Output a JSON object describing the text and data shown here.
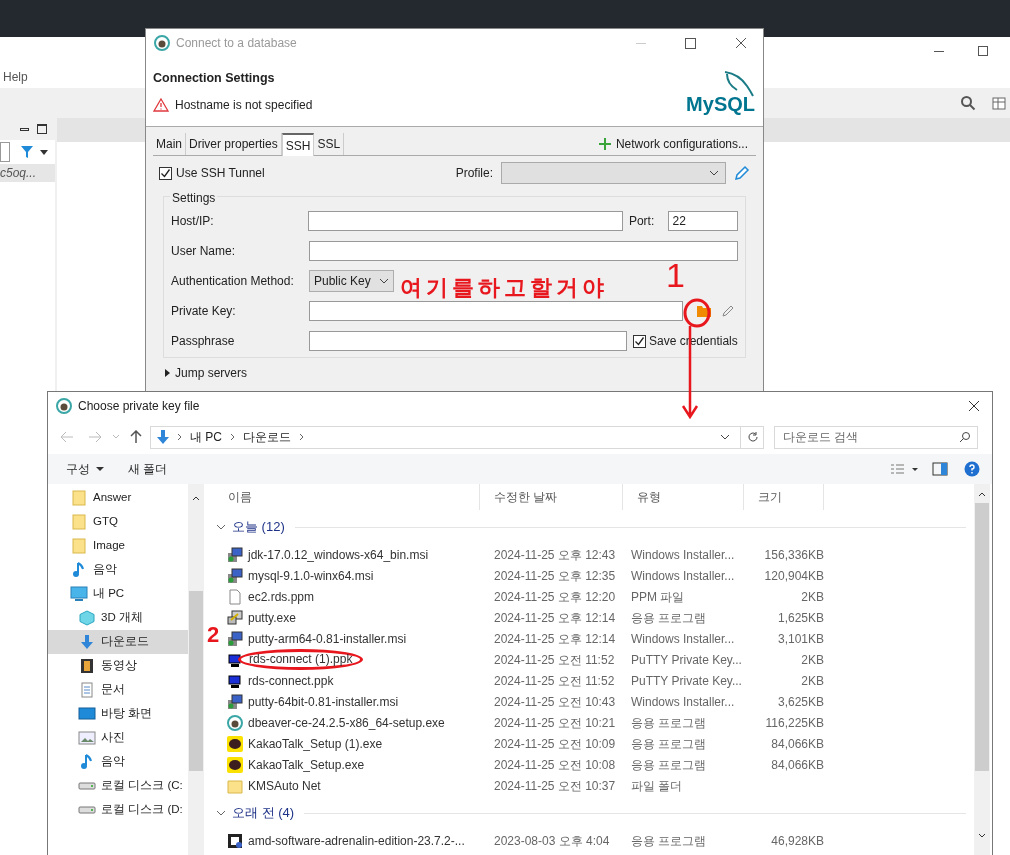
{
  "background_app": {
    "menu": [
      "Help"
    ],
    "panel_item": "c5oq..."
  },
  "connection_dialog": {
    "title": "Connect to a database",
    "heading": "Connection Settings",
    "warning": "Hostname is not specified",
    "logo": "MySQL",
    "tabs": [
      {
        "label": "Main",
        "selected": false
      },
      {
        "label": "Driver properties",
        "selected": false
      },
      {
        "label": "SSH",
        "selected": true
      },
      {
        "label": "SSL",
        "selected": false
      }
    ],
    "network_button": "Network configurations...",
    "use_ssh_tunnel": {
      "label": "Use SSH Tunnel",
      "checked": true
    },
    "profile_label": "Profile:",
    "settings": {
      "title": "Settings",
      "host_label": "Host/IP:",
      "port_label": "Port:",
      "port_value": "22",
      "user_label": "User Name:",
      "auth_label": "Authentication Method:",
      "auth_value": "Public Key",
      "private_key_label": "Private Key:",
      "passphrase_label": "Passphrase",
      "save_credentials": {
        "label": "Save credentials",
        "checked": true
      }
    },
    "sections": [
      {
        "label": "Jump servers",
        "expanded": false
      }
    ]
  },
  "file_dialog": {
    "title": "Choose private key file",
    "breadcrumb": [
      "내 PC",
      "다운로드"
    ],
    "search_placeholder": "다운로드 검색",
    "toolbar": [
      "구성",
      "새 폴더"
    ],
    "nav": [
      {
        "label": "Answer",
        "kind": "folder",
        "selected": false
      },
      {
        "label": "GTQ",
        "kind": "folder",
        "selected": false
      },
      {
        "label": "Image",
        "kind": "folder",
        "selected": false
      },
      {
        "label": "음악",
        "kind": "music",
        "selected": false
      },
      {
        "label": "내 PC",
        "kind": "pc",
        "selected": false,
        "children": [
          {
            "label": "3D 개체",
            "kind": "cube",
            "selected": false
          },
          {
            "label": "다운로드",
            "kind": "download",
            "selected": true
          },
          {
            "label": "동영상",
            "kind": "film",
            "selected": false
          },
          {
            "label": "문서",
            "kind": "doc",
            "selected": false
          },
          {
            "label": "바탕 화면",
            "kind": "desktop",
            "selected": false
          },
          {
            "label": "사진",
            "kind": "photo",
            "selected": false
          },
          {
            "label": "음악",
            "kind": "music",
            "selected": false
          },
          {
            "label": "로컬 디스크 (C:",
            "kind": "disk",
            "selected": false
          },
          {
            "label": "로컬 디스크 (D:",
            "kind": "disk",
            "selected": false
          }
        ]
      }
    ],
    "columns": [
      "이름",
      "수정한 날짜",
      "유형",
      "크기"
    ],
    "groups": [
      {
        "label": "오늘 (12)",
        "expanded": true,
        "files": [
          {
            "name": "jdk-17.0.12_windows-x64_bin.msi",
            "date": "2024-11-25 오후 12:43",
            "type": "Windows Installer...",
            "size": "156,336KB",
            "kind": "installer"
          },
          {
            "name": "mysql-9.1.0-winx64.msi",
            "date": "2024-11-25 오후 12:35",
            "type": "Windows Installer...",
            "size": "120,904KB",
            "kind": "installer"
          },
          {
            "name": "ec2.rds.ppm",
            "date": "2024-11-25 오후 12:20",
            "type": "PPM 파일",
            "size": "2KB",
            "kind": "document"
          },
          {
            "name": "putty.exe",
            "date": "2024-11-25 오후 12:14",
            "type": "응용 프로그램",
            "size": "1,625KB",
            "kind": "putty"
          },
          {
            "name": "putty-arm64-0.81-installer.msi",
            "date": "2024-11-25 오후 12:14",
            "type": "Windows Installer...",
            "size": "3,101KB",
            "kind": "installer"
          },
          {
            "name": "rds-connect (1).ppk",
            "date": "2024-11-25 오전 11:52",
            "type": "PuTTY Private Key...",
            "size": "2KB",
            "kind": "key",
            "circled": true
          },
          {
            "name": "rds-connect.ppk",
            "date": "2024-11-25 오전 11:52",
            "type": "PuTTY Private Key...",
            "size": "2KB",
            "kind": "key"
          },
          {
            "name": "putty-64bit-0.81-installer.msi",
            "date": "2024-11-25 오전 10:43",
            "type": "Windows Installer...",
            "size": "3,625KB",
            "kind": "installer"
          },
          {
            "name": "dbeaver-ce-24.2.5-x86_64-setup.exe",
            "date": "2024-11-25 오전 10:21",
            "type": "응용 프로그램",
            "size": "116,225KB",
            "kind": "beaver"
          },
          {
            "name": "KakaoTalk_Setup (1).exe",
            "date": "2024-11-25 오전 10:09",
            "type": "응용 프로그램",
            "size": "84,066KB",
            "kind": "chat"
          },
          {
            "name": "KakaoTalk_Setup.exe",
            "date": "2024-11-25 오전 10:08",
            "type": "응용 프로그램",
            "size": "84,066KB",
            "kind": "chat"
          },
          {
            "name": "KMSAuto Net",
            "date": "2024-11-25 오전 10:37",
            "type": "파일 폴더",
            "kind": "folder"
          }
        ]
      },
      {
        "label": "오래 전 (4)",
        "expanded": true,
        "files": [
          {
            "name": "amd-software-adrenalin-edition-23.7.2-...",
            "date": "2023-08-03 오후 4:04",
            "type": "응용 프로그램",
            "size": "46,928KB",
            "kind": "amd"
          }
        ]
      }
    ]
  },
  "annotations": {
    "note": "여기를하고할거야",
    "step_1": "1",
    "step_2": "2"
  }
}
